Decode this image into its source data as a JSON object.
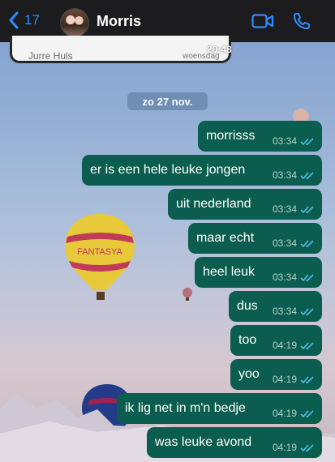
{
  "header": {
    "back_count": "17",
    "contact_name": "Morris"
  },
  "previous_message": {
    "sender": "Jurre Huls",
    "day": "woensdag",
    "time": "20:48"
  },
  "date_separator": "zo 27 nov.",
  "messages": [
    {
      "text": "morrisss",
      "time": "03:34"
    },
    {
      "text": "er is een hele leuke jongen",
      "time": "03:34"
    },
    {
      "text": "uit nederland",
      "time": "03:34"
    },
    {
      "text": "maar echt",
      "time": "03:34"
    },
    {
      "text": "heel leuk",
      "time": "03:34"
    },
    {
      "text": "dus",
      "time": "03:34"
    },
    {
      "text": "too",
      "time": "04:19"
    },
    {
      "text": "yoo",
      "time": "04:19"
    },
    {
      "text": "ik lig net in m'n bedje",
      "time": "04:19"
    },
    {
      "text": "was leuke avond",
      "time": "04:19"
    }
  ],
  "colors": {
    "header_bg": "#1c1c1e",
    "accent_blue": "#2f8cff",
    "bubble_out": "#0b5e4f",
    "read_ticks": "#53bdeb"
  },
  "icons": {
    "back": "chevron-left-icon",
    "video": "video-camera-icon",
    "call": "phone-icon",
    "read": "double-check-icon"
  }
}
